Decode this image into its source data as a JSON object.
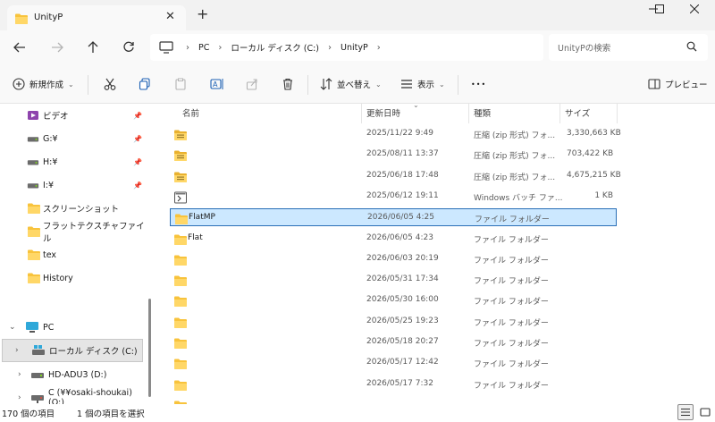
{
  "window": {
    "tab_title": "UnityP",
    "new_tab_label": "+"
  },
  "nav": {
    "breadcrumbs": [
      "PC",
      "ローカル ディスク (C:)",
      "UnityP"
    ],
    "search_placeholder": "UnityPの検索"
  },
  "toolbar": {
    "new_label": "新規作成",
    "sort_label": "並べ替え",
    "view_label": "表示",
    "more_label": "•••",
    "preview_label": "プレビュー"
  },
  "sidebar": {
    "quick_items": [
      {
        "label": "ビデオ",
        "icon": "video-icon",
        "pinned": true
      },
      {
        "label": "G:¥",
        "icon": "drive-icon",
        "pinned": true
      },
      {
        "label": "H:¥",
        "icon": "drive-icon",
        "pinned": true
      },
      {
        "label": "I:¥",
        "icon": "drive-icon",
        "pinned": true
      },
      {
        "label": "スクリーンショット",
        "icon": "folder-icon",
        "pinned": false
      },
      {
        "label": "フラットテクスチャファイル",
        "icon": "folder-icon",
        "pinned": false
      },
      {
        "label": "tex",
        "icon": "folder-icon",
        "pinned": false
      },
      {
        "label": "History",
        "icon": "folder-icon",
        "pinned": false
      }
    ],
    "pc_label": "PC",
    "drives": [
      {
        "label": "ローカル ディスク (C:)",
        "selected": true
      },
      {
        "label": "HD-ADU3 (D:)",
        "selected": false
      },
      {
        "label": "C (¥¥osaki-shoukai) (O:)",
        "selected": false
      }
    ]
  },
  "columns": {
    "name": "名前",
    "date": "更新日時",
    "type": "種類",
    "size": "サイズ"
  },
  "files": [
    {
      "name": "",
      "date": "2025/11/22 9:49",
      "type": "圧縮 (zip 形式) フォ...",
      "size": "3,330,663 KB",
      "icon": "zip-folder-icon"
    },
    {
      "name": "",
      "date": "2025/08/11 13:37",
      "type": "圧縮 (zip 形式) フォ...",
      "size": "703,422 KB",
      "icon": "zip-folder-icon"
    },
    {
      "name": "",
      "date": "2025/06/18 17:48",
      "type": "圧縮 (zip 形式) フォ...",
      "size": "4,675,215 KB",
      "icon": "zip-folder-icon"
    },
    {
      "name": "",
      "date": "2025/06/12 19:11",
      "type": "Windows バッチ ファ...",
      "size": "1 KB",
      "icon": "batch-file-icon"
    },
    {
      "name": "FlatMP",
      "date": "2026/06/05 4:25",
      "type": "ファイル フォルダー",
      "size": "",
      "icon": "folder-icon",
      "selected": true
    },
    {
      "name": "Flat",
      "date": "2026/06/05 4:23",
      "type": "ファイル フォルダー",
      "size": "",
      "icon": "folder-icon"
    },
    {
      "name": "",
      "date": "2026/06/03 20:19",
      "type": "ファイル フォルダー",
      "size": "",
      "icon": "folder-icon"
    },
    {
      "name": "",
      "date": "2026/05/31 17:34",
      "type": "ファイル フォルダー",
      "size": "",
      "icon": "folder-icon"
    },
    {
      "name": "",
      "date": "2026/05/30 16:00",
      "type": "ファイル フォルダー",
      "size": "",
      "icon": "folder-icon"
    },
    {
      "name": "",
      "date": "2026/05/25 19:23",
      "type": "ファイル フォルダー",
      "size": "",
      "icon": "folder-icon"
    },
    {
      "name": "",
      "date": "2026/05/18 20:27",
      "type": "ファイル フォルダー",
      "size": "",
      "icon": "folder-icon"
    },
    {
      "name": "",
      "date": "2026/05/17 12:42",
      "type": "ファイル フォルダー",
      "size": "",
      "icon": "folder-icon"
    },
    {
      "name": "",
      "date": "2026/05/17 7:32",
      "type": "ファイル フォルダー",
      "size": "",
      "icon": "folder-icon"
    },
    {
      "name": "",
      "date": "",
      "type": "",
      "size": "",
      "icon": "folder-icon"
    }
  ],
  "status": {
    "item_count": "170 個の項目",
    "selected_count": "1 個の項目を選択"
  },
  "colors": {
    "accent": "#0067c0",
    "selection_bg": "#cce8ff",
    "folder": "#f8c33c"
  }
}
